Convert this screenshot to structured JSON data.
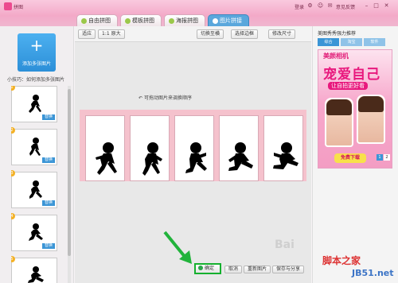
{
  "app": {
    "title": "拼图"
  },
  "top_right": {
    "login": "登录",
    "settings_icon": "gear-icon",
    "feedback": "意见反馈"
  },
  "tabs": [
    {
      "label": "自由拼图",
      "active": false
    },
    {
      "label": "模板拼图",
      "active": false
    },
    {
      "label": "海报拼图",
      "active": false
    },
    {
      "label": "图片拼接",
      "active": true
    }
  ],
  "sidebar": {
    "add_button_label": "添加多张图片",
    "hint": "小技巧：如何添加多张图片",
    "thumbnails": [
      {
        "num": "1",
        "tag": "替换"
      },
      {
        "num": "2",
        "tag": "替换"
      },
      {
        "num": "3",
        "tag": "替换"
      },
      {
        "num": "4",
        "tag": "替换"
      },
      {
        "num": "5",
        "tag": "替换"
      }
    ]
  },
  "toolbar": {
    "fit_label": "适应",
    "original_label": "1:1 原大",
    "switch_label": "切换至横",
    "border_label": "选择边框",
    "size_label": "修改尺寸"
  },
  "canvas": {
    "drag_hint": "可拖动图片来调换顺序",
    "frames": 5
  },
  "footer": {
    "confirm_label": "确定",
    "cancel_label": "取消",
    "reset_label": "重新图片",
    "save_label": "保存与分享"
  },
  "right_panel": {
    "title": "美图秀秀强力推荐",
    "tabs": [
      "综合",
      "淘宝",
      "软件"
    ],
    "ad_brand": "美颜相机",
    "ad_big": "宠爱自己",
    "ad_sub": "让自拍更好看",
    "ad_download": "免费下载",
    "ad_pages": [
      "1",
      "2"
    ]
  },
  "watermarks": {
    "baidu": "Bai",
    "site_main": "脚本之家",
    "site_url": "JB51.net"
  },
  "colors": {
    "accent": "#3b95d6",
    "titlebar": "#f3a9c8",
    "strip_bg": "#f5c2cd",
    "highlight": "#15b02e"
  }
}
